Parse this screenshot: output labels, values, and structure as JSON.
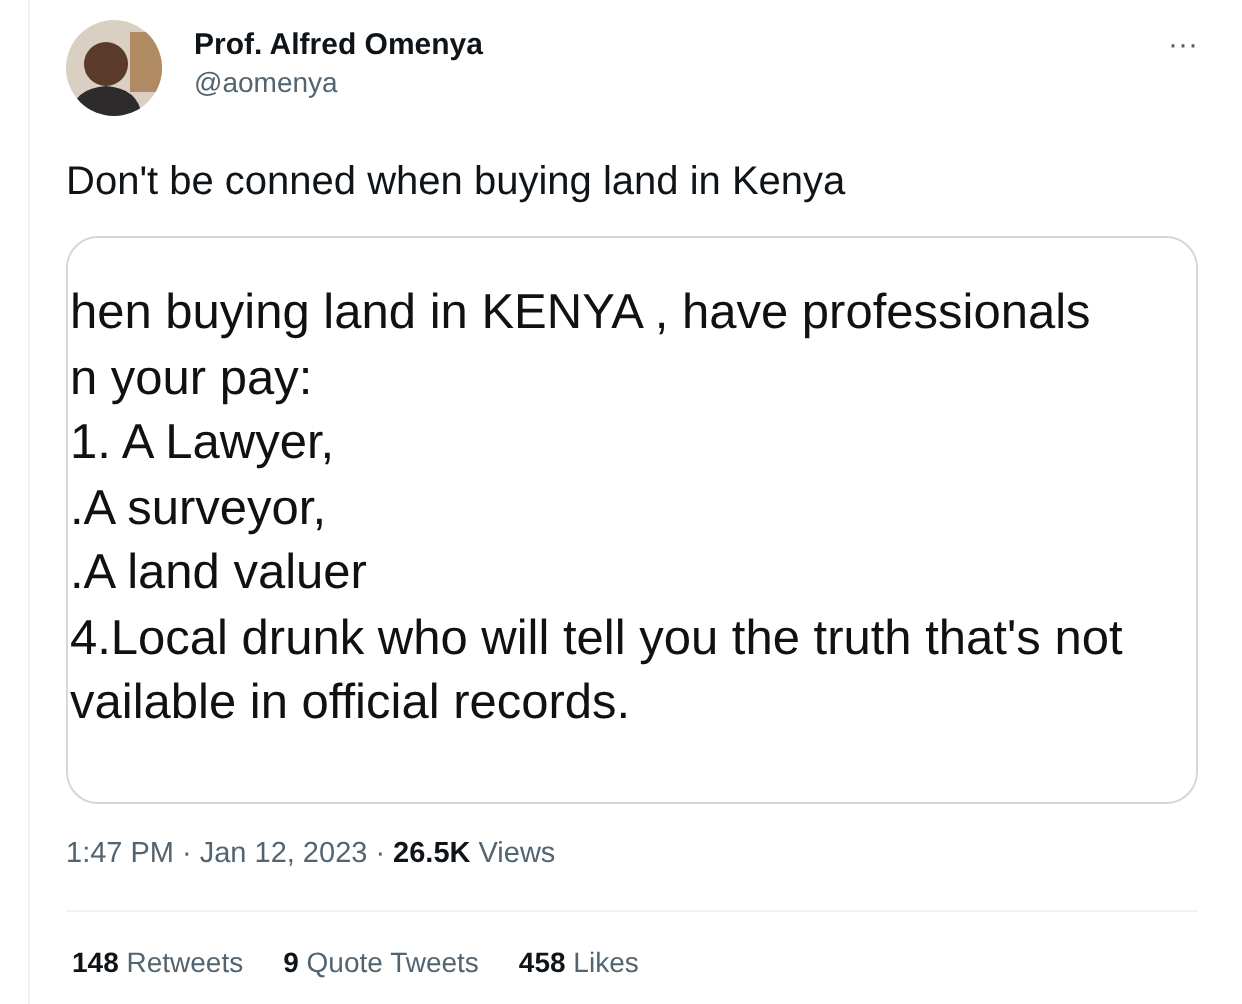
{
  "author": {
    "name": "Prof. Alfred Omenya",
    "handle": "@aomenya"
  },
  "more": "···",
  "text": "Don't be conned when buying land in Kenya",
  "image_lines": [
    "hen buying land in KENYA , have professionals",
    "n your pay:",
    "1. A Lawyer,",
    ".A surveyor,",
    ".A land valuer",
    "4.Local drunk who will tell you the truth that's not",
    "vailable in official records."
  ],
  "meta": {
    "time": "1:47 PM",
    "sep1": "·",
    "date": "Jan 12, 2023",
    "sep2": "·",
    "views_count": "26.5K",
    "views_label": "Views"
  },
  "stats": [
    {
      "count": "148",
      "label": "Retweets"
    },
    {
      "count": "9",
      "label": "Quote Tweets"
    },
    {
      "count": "458",
      "label": "Likes"
    }
  ]
}
